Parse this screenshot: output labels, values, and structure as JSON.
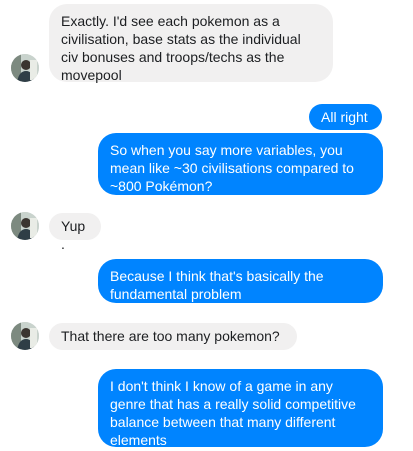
{
  "colors": {
    "incoming_bg": "#f1f0f0",
    "outgoing_bg": "#0084ff",
    "incoming_text": "#1c1e21",
    "outgoing_text": "#ffffff"
  },
  "messages": [
    {
      "side": "incoming",
      "text": "Exactly. I'd see each pokemon as a civilisation, base stats as the individual civ bonuses and troops/techs as the movepool"
    },
    {
      "side": "outgoing",
      "text": "All right"
    },
    {
      "side": "outgoing",
      "text": "So when you say more variables, you mean like ~30 civilisations compared to ~800 Pokémon?"
    },
    {
      "side": "incoming",
      "text": "Yup."
    },
    {
      "side": "outgoing",
      "text": "Because I think that's basically the fundamental problem"
    },
    {
      "side": "incoming",
      "text": "That there are too many pokemon?"
    },
    {
      "side": "outgoing",
      "text": "I don't think I know of a game in any genre that has a really solid competitive balance between that many different elements"
    }
  ],
  "avatar_icon": "contact-avatar-icon"
}
